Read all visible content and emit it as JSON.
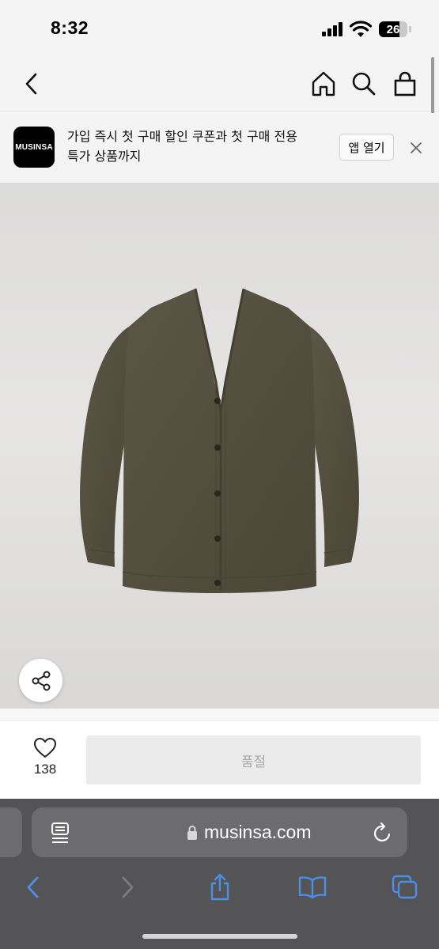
{
  "status_bar": {
    "time": "8:32",
    "battery": "26"
  },
  "nav": {
    "icons": [
      "back-icon",
      "home-icon",
      "search-icon",
      "shopping-bag-icon"
    ]
  },
  "app_banner": {
    "logo_text": "MUSINSA",
    "line1": "가입 즉시 첫 구매 할인 쿠폰과 첫 구매 전용",
    "line2": "특가 상품까지",
    "open_app_label": "앱 열기",
    "close_icon": "close-icon"
  },
  "product": {
    "image_alt": "brown v-neck knit cardigan",
    "share_icon": "share-icon"
  },
  "purchase": {
    "like_icon": "heart-icon",
    "like_count": "138",
    "soldout_label": "품절"
  },
  "browser": {
    "url": "musinsa.com",
    "icons": [
      "page-settings-icon",
      "lock-icon",
      "reload-icon",
      "back-arrow-icon",
      "forward-arrow-icon",
      "share-icon",
      "bookmarks-icon",
      "tabs-icon"
    ]
  },
  "colors": {
    "accent_blue": "#4a8fe7",
    "soldout_bg": "#ebebeb",
    "soldout_text": "#a9a9a9",
    "cardigan": "#56503f"
  }
}
